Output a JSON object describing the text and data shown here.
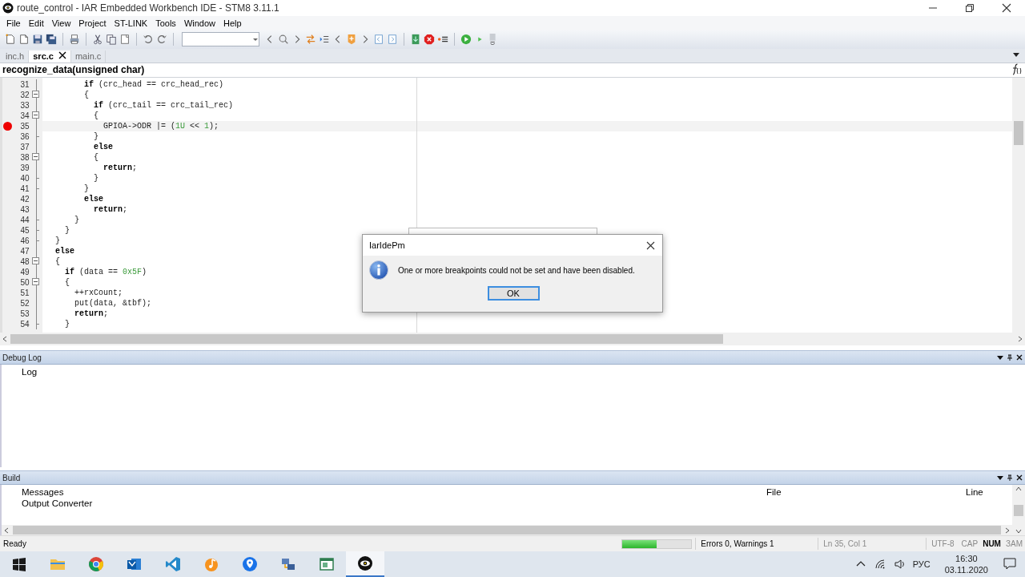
{
  "window": {
    "title": "route_control - IAR Embedded Workbench IDE - STM8 3.11.1"
  },
  "menu": [
    "File",
    "Edit",
    "View",
    "Project",
    "ST-LINK",
    "Tools",
    "Window",
    "Help"
  ],
  "tabs": [
    {
      "label": "inc.h",
      "selected": false,
      "closable": false
    },
    {
      "label": "src.c",
      "selected": true,
      "closable": true
    },
    {
      "label": "main.c",
      "selected": false,
      "closable": false
    }
  ],
  "function_bar": {
    "text": "recognize_data(unsigned char)"
  },
  "editor": {
    "lines": [
      {
        "number": "31",
        "kind": "body",
        "breakpoint": false,
        "current": false,
        "code": [
          {
            "text": "        if",
            "kind": "keyword"
          },
          {
            "text": " (crc_head == crc_head_rec)",
            "kind": "plain"
          }
        ]
      },
      {
        "number": "32",
        "kind": "open",
        "breakpoint": false,
        "current": false,
        "code": [
          {
            "text": "        {",
            "kind": "plain"
          }
        ]
      },
      {
        "number": "33",
        "kind": "body",
        "breakpoint": false,
        "current": false,
        "code": [
          {
            "text": "          if",
            "kind": "keyword"
          },
          {
            "text": " (crc_tail == crc_tail_rec)",
            "kind": "plain"
          }
        ]
      },
      {
        "number": "34",
        "kind": "open",
        "breakpoint": false,
        "current": false,
        "code": [
          {
            "text": "          {",
            "kind": "plain"
          }
        ]
      },
      {
        "number": "35",
        "kind": "body",
        "breakpoint": true,
        "current": true,
        "code": [
          {
            "text": "            GPIOA->ODR |= (",
            "kind": "plain"
          },
          {
            "text": "1U",
            "kind": "number"
          },
          {
            "text": " << ",
            "kind": "plain"
          },
          {
            "text": "1",
            "kind": "number"
          },
          {
            "text": ");",
            "kind": "plain"
          }
        ]
      },
      {
        "number": "36",
        "kind": "close",
        "breakpoint": false,
        "current": false,
        "code": [
          {
            "text": "          }",
            "kind": "plain"
          }
        ]
      },
      {
        "number": "37",
        "kind": "body",
        "breakpoint": false,
        "current": false,
        "code": [
          {
            "text": "          else",
            "kind": "keyword"
          }
        ]
      },
      {
        "number": "38",
        "kind": "open",
        "breakpoint": false,
        "current": false,
        "code": [
          {
            "text": "          {",
            "kind": "plain"
          }
        ]
      },
      {
        "number": "39",
        "kind": "body",
        "breakpoint": false,
        "current": false,
        "code": [
          {
            "text": "            return",
            "kind": "keyword"
          },
          {
            "text": ";",
            "kind": "plain"
          }
        ]
      },
      {
        "number": "40",
        "kind": "close",
        "breakpoint": false,
        "current": false,
        "code": [
          {
            "text": "          }",
            "kind": "plain"
          }
        ]
      },
      {
        "number": "41",
        "kind": "close",
        "breakpoint": false,
        "current": false,
        "code": [
          {
            "text": "        }",
            "kind": "plain"
          }
        ]
      },
      {
        "number": "42",
        "kind": "body",
        "breakpoint": false,
        "current": false,
        "code": [
          {
            "text": "        else",
            "kind": "keyword"
          }
        ]
      },
      {
        "number": "43",
        "kind": "body",
        "breakpoint": false,
        "current": false,
        "code": [
          {
            "text": "          return",
            "kind": "keyword"
          },
          {
            "text": ";",
            "kind": "plain"
          }
        ]
      },
      {
        "number": "44",
        "kind": "close",
        "breakpoint": false,
        "current": false,
        "code": [
          {
            "text": "      }",
            "kind": "plain"
          }
        ]
      },
      {
        "number": "45",
        "kind": "close",
        "breakpoint": false,
        "current": false,
        "code": [
          {
            "text": "    }",
            "kind": "plain"
          }
        ]
      },
      {
        "number": "46",
        "kind": "close",
        "breakpoint": false,
        "current": false,
        "code": [
          {
            "text": "  }",
            "kind": "plain"
          }
        ]
      },
      {
        "number": "47",
        "kind": "body",
        "breakpoint": false,
        "current": false,
        "code": [
          {
            "text": "  else",
            "kind": "keyword"
          }
        ]
      },
      {
        "number": "48",
        "kind": "open",
        "breakpoint": false,
        "current": false,
        "code": [
          {
            "text": "  {",
            "kind": "plain"
          }
        ]
      },
      {
        "number": "49",
        "kind": "body",
        "breakpoint": false,
        "current": false,
        "code": [
          {
            "text": "    if",
            "kind": "keyword"
          },
          {
            "text": " (data == ",
            "kind": "plain"
          },
          {
            "text": "0x5F",
            "kind": "number"
          },
          {
            "text": ")",
            "kind": "plain"
          }
        ]
      },
      {
        "number": "50",
        "kind": "open",
        "breakpoint": false,
        "current": false,
        "code": [
          {
            "text": "    {",
            "kind": "plain"
          }
        ]
      },
      {
        "number": "51",
        "kind": "body",
        "breakpoint": false,
        "current": false,
        "code": [
          {
            "text": "      ++rxCount;",
            "kind": "plain"
          }
        ]
      },
      {
        "number": "52",
        "kind": "body",
        "breakpoint": false,
        "current": false,
        "code": [
          {
            "text": "      put(data, &tbf);",
            "kind": "plain"
          }
        ]
      },
      {
        "number": "53",
        "kind": "body",
        "breakpoint": false,
        "current": false,
        "code": [
          {
            "text": "      return",
            "kind": "keyword"
          },
          {
            "text": ";",
            "kind": "plain"
          }
        ]
      },
      {
        "number": "54",
        "kind": "close",
        "breakpoint": false,
        "current": false,
        "code": [
          {
            "text": "    }",
            "kind": "plain"
          }
        ]
      }
    ]
  },
  "debug_log": {
    "title": "Debug Log",
    "columns": [
      "Log"
    ]
  },
  "build": {
    "title": "Build",
    "columns": [
      "Messages",
      "File",
      "Line"
    ],
    "rows": [
      {
        "message": "Output Converter"
      }
    ]
  },
  "status_bar": {
    "text": "Ready",
    "progress": {
      "level": 0.5
    },
    "errors": "Errors 0, Warnings 1",
    "position": "Ln 35, Col 1",
    "encoding": "UTF-8",
    "indicators": [
      {
        "label": "CAP",
        "on": false
      },
      {
        "label": "NUM",
        "on": true
      },
      {
        "label": "ЗАМ",
        "on": false
      }
    ]
  },
  "dialog": {
    "title": "IarIdePm",
    "message": "One or more breakpoints could not be set and have been disabled.",
    "buttons": [
      {
        "label": "OK",
        "default": true
      }
    ]
  },
  "taskbar": {
    "apps": [
      {
        "active": false
      },
      {
        "active": false
      },
      {
        "active": false
      },
      {
        "active": false
      },
      {
        "active": false
      },
      {
        "active": false
      },
      {
        "active": false
      },
      {
        "active": false
      },
      {
        "active": true
      }
    ],
    "language": "РУС",
    "time": "16:30",
    "date": "03.11.2020"
  }
}
